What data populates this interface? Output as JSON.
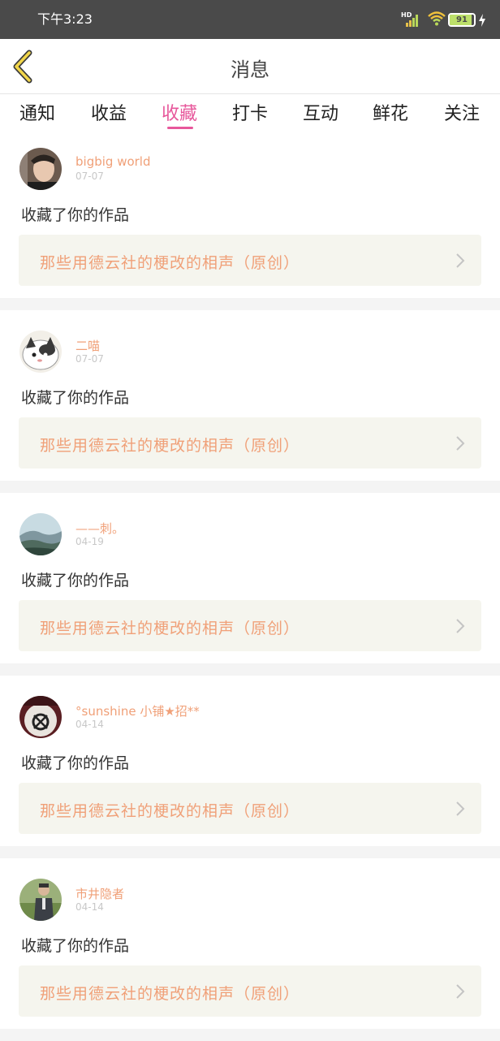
{
  "status_bar": {
    "time": "下午3:23",
    "network_label": "HD",
    "battery_level": "91",
    "battery_fill_percent": 91,
    "icons": [
      "signal-icon",
      "wifi-icon",
      "battery-icon",
      "charging-icon"
    ]
  },
  "header": {
    "title": "消息",
    "back_icon": "chevron-left-icon"
  },
  "tabs": [
    {
      "label": "通知",
      "active": false
    },
    {
      "label": "收益",
      "active": false
    },
    {
      "label": "收藏",
      "active": true
    },
    {
      "label": "打卡",
      "active": false
    },
    {
      "label": "互动",
      "active": false
    },
    {
      "label": "鲜花",
      "active": false
    },
    {
      "label": "关注",
      "active": false
    }
  ],
  "colors": {
    "accent": "#e7579b",
    "username": "#f0a078",
    "work_box": "#f5f5ee",
    "date": "#c8c8c8",
    "statusbar": "#4a4a4a"
  },
  "messages": [
    {
      "username": "bigbig world",
      "date": "07-07",
      "action": "收藏了你的作品",
      "work_title": "那些用德云社的梗改的相声（原创）"
    },
    {
      "username": "二喵",
      "date": "07-07",
      "action": "收藏了你的作品",
      "work_title": "那些用德云社的梗改的相声（原创）"
    },
    {
      "username": "——刺。",
      "date": "04-19",
      "action": "收藏了你的作品",
      "work_title": "那些用德云社的梗改的相声（原创）"
    },
    {
      "username": "°sunshine 小铺★招**",
      "date": "04-14",
      "action": "收藏了你的作品",
      "work_title": "那些用德云社的梗改的相声（原创）"
    },
    {
      "username": "市井隐者",
      "date": "04-14",
      "action": "收藏了你的作品",
      "work_title": "那些用德云社的梗改的相声（原创）"
    }
  ]
}
